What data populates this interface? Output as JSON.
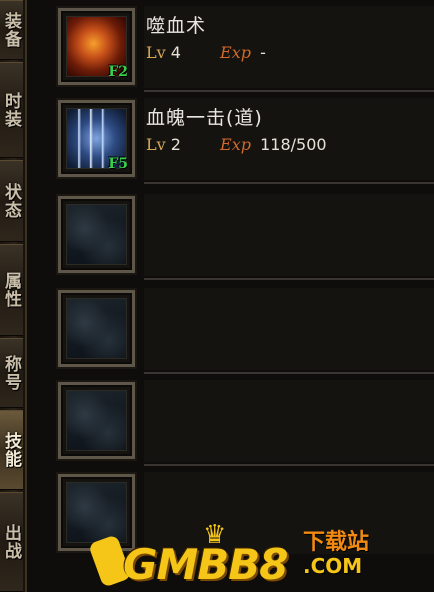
{
  "side_tabs": [
    {
      "label": "装备",
      "active": false
    },
    {
      "label": "时装",
      "active": false
    },
    {
      "label": "状态",
      "active": false
    },
    {
      "label": "属性",
      "active": false
    },
    {
      "label": "称号",
      "active": false
    },
    {
      "label": "技能",
      "active": true
    },
    {
      "label": "出战",
      "active": false
    }
  ],
  "skills": [
    {
      "name": "噬血术",
      "hotkey": "F2",
      "lv_label": "Lv",
      "level": "4",
      "exp_label": "Exp",
      "exp": "-",
      "icon": "blood-skill-icon"
    },
    {
      "name": "血魄一击(道)",
      "hotkey": "F5",
      "lv_label": "Lv",
      "level": "2",
      "exp_label": "Exp",
      "exp": "118/500",
      "icon": "blood-strike-skill-icon"
    },
    {
      "empty": true
    },
    {
      "empty": true
    },
    {
      "empty": true
    },
    {
      "empty": true
    }
  ],
  "watermark": {
    "logo": "GMBB8",
    "tag": "下载站",
    "domain": ".COM"
  },
  "colors": {
    "hotkey": "#37d24a",
    "level_label": "#d6a85a",
    "exp_label": "#cf6a2a",
    "slot_border": "#5f564a",
    "watermark": "#f5c518"
  }
}
